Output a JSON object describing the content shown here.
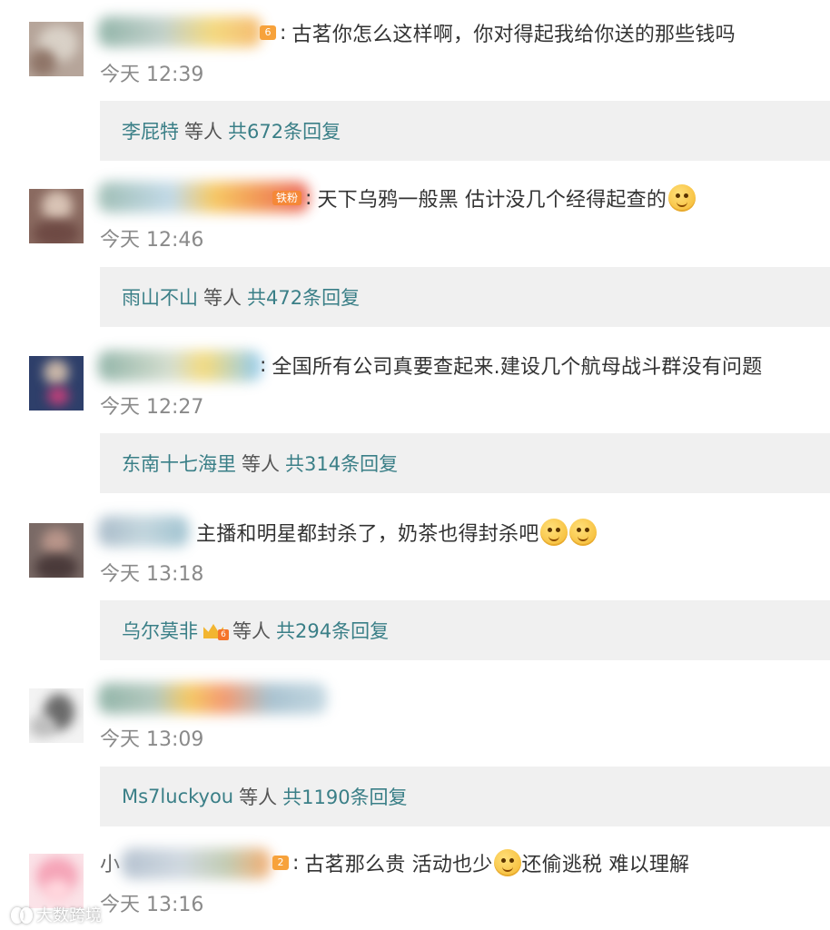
{
  "comments": [
    {
      "text": "古茗你怎么这样啊，你对得起我给你送的那些钱吗",
      "time": "今天 12:39",
      "badge": "6",
      "reply": {
        "name": "李屁特",
        "mid": "等人",
        "count": "共672条回复"
      }
    },
    {
      "text": "天下乌鸦一般黑 估计没几个经得起查的",
      "time": "今天 12:46",
      "badge": "铁粉",
      "emoji": "smile-emoji",
      "reply": {
        "name": "雨山不山",
        "mid": "等人",
        "count": "共472条回复"
      }
    },
    {
      "text": "全国所有公司真要查起来.建设几个航母战斗群没有问题",
      "time": "今天 12:27",
      "reply": {
        "name": "东南十七海里",
        "mid": "等人",
        "count": "共314条回复"
      }
    },
    {
      "text": "主播和明星都封杀了，奶茶也得封杀吧",
      "time": "今天 13:18",
      "emoji": "doge-emoji",
      "reply": {
        "name": "乌尔莫非",
        "mid": "等人",
        "count": "共294条回复",
        "badge": "6"
      }
    },
    {
      "text": "",
      "time": "今天 13:09",
      "reply": {
        "name": "Ms7luckyou",
        "mid": "等人",
        "count": "共1190条回复"
      }
    },
    {
      "name_prefix": "小",
      "text": "古茗那么贵 活动也少",
      "text2": "还偷逃税 难以理解",
      "time": "今天 13:16",
      "badge": "2",
      "emoji": "sleepy-emoji"
    }
  ],
  "watermark": {
    "text": "大数跨境",
    "icon": "logo-icon"
  },
  "colors": {
    "reply_link": "#3a7f87",
    "reply_bg": "#f0f0f0",
    "time": "#8a8a8a",
    "text": "#333333",
    "badge": "#f7a23b"
  }
}
